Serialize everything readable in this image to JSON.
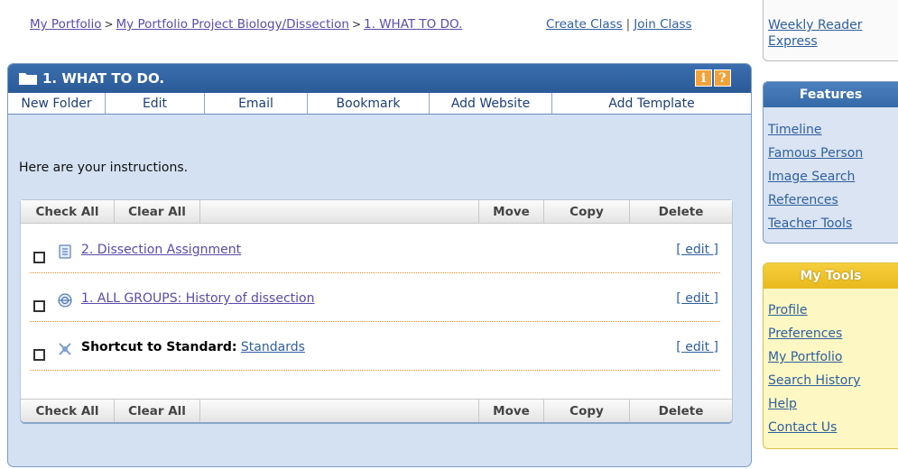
{
  "breadcrumb": {
    "items": [
      "My Portfolio",
      "My Portfolio Project Biology/Dissection",
      "1. WHAT TO DO."
    ],
    "separator": ">"
  },
  "top_links": {
    "create_class": "Create Class",
    "join_class": "Join Class",
    "divider": "|"
  },
  "sidebar_top": {
    "link": "Weekly Reader Express"
  },
  "panel": {
    "title": "1. WHAT TO DO.",
    "info_icon": "i",
    "help_icon": "?",
    "toolbar": [
      "New Folder",
      "Edit",
      "Email",
      "Bookmark",
      "Add Website",
      "Add Template"
    ],
    "instructions": "Here are your instructions."
  },
  "actions": {
    "check_all": "Check All",
    "clear_all": "Clear All",
    "move": "Move",
    "copy": "Copy",
    "delete": "Delete"
  },
  "items": [
    {
      "icon": "document-icon",
      "prefix": "",
      "title": "2. Dissection Assignment",
      "edit": "[ edit ]"
    },
    {
      "icon": "website-icon",
      "prefix": "",
      "title": "1. ALL GROUPS: History of dissection",
      "edit": "[ edit ]"
    },
    {
      "icon": "shortcut-icon",
      "prefix": "Shortcut to Standard:",
      "title": "Standards",
      "edit": "[ edit ]"
    }
  ],
  "features": {
    "title": "Features",
    "items": [
      "Timeline",
      "Famous Person",
      "Image Search",
      "References",
      "Teacher Tools"
    ]
  },
  "my_tools": {
    "title": "My Tools",
    "items": [
      "Profile",
      "Preferences",
      "My Portfolio",
      "Search History",
      "Help",
      "Contact Us"
    ]
  },
  "colors": {
    "panel_header": "#2b5a98",
    "panel_bg": "#d4e1f2",
    "tools_bg": "#fdf7c3",
    "link": "#5b4ba8",
    "divider": "#e08a25"
  }
}
